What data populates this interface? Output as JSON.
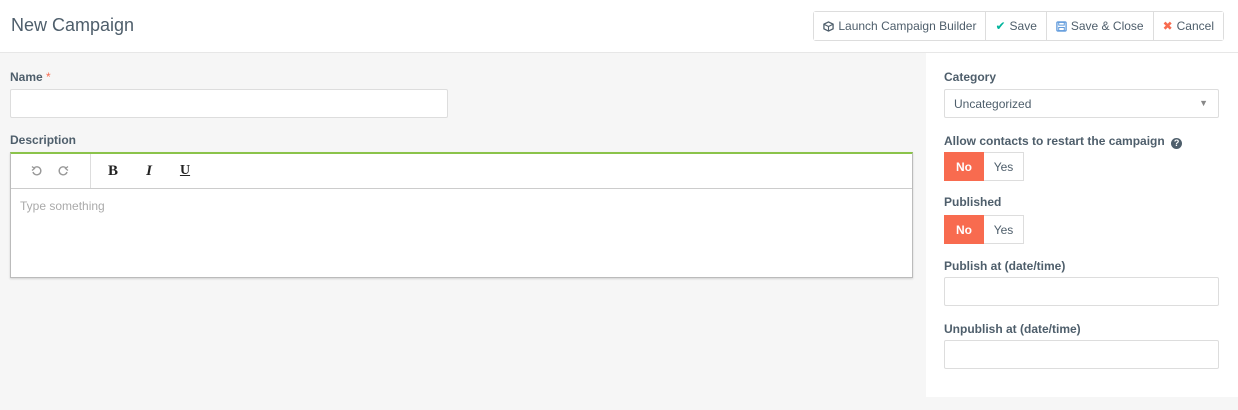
{
  "header": {
    "title": "New Campaign",
    "buttons": {
      "launch_builder": "Launch Campaign Builder",
      "save": "Save",
      "save_close": "Save & Close",
      "cancel": "Cancel"
    }
  },
  "form": {
    "name_label": "Name",
    "name_required_marker": "*",
    "name_value": "",
    "description_label": "Description",
    "editor_placeholder": "Type something",
    "toolbar": {
      "bold": "B",
      "italic": "I",
      "underline": "U"
    }
  },
  "sidebar": {
    "category_label": "Category",
    "category_value": "Uncategorized",
    "restart_label": "Allow contacts to restart the campaign",
    "restart_options": [
      "No",
      "Yes"
    ],
    "restart_selected": "No",
    "published_label": "Published",
    "published_options": [
      "No",
      "Yes"
    ],
    "published_selected": "No",
    "publish_at_label": "Publish at (date/time)",
    "publish_at_value": "",
    "unpublish_at_label": "Unpublish at (date/time)",
    "unpublish_at_value": ""
  },
  "colors": {
    "accent_active": "#f86b4f",
    "save_icon": "#00b49c",
    "save_close_icon": "#4e8fd8",
    "cancel_icon": "#f86b4f",
    "editor_focus_border": "#8bc34a"
  }
}
